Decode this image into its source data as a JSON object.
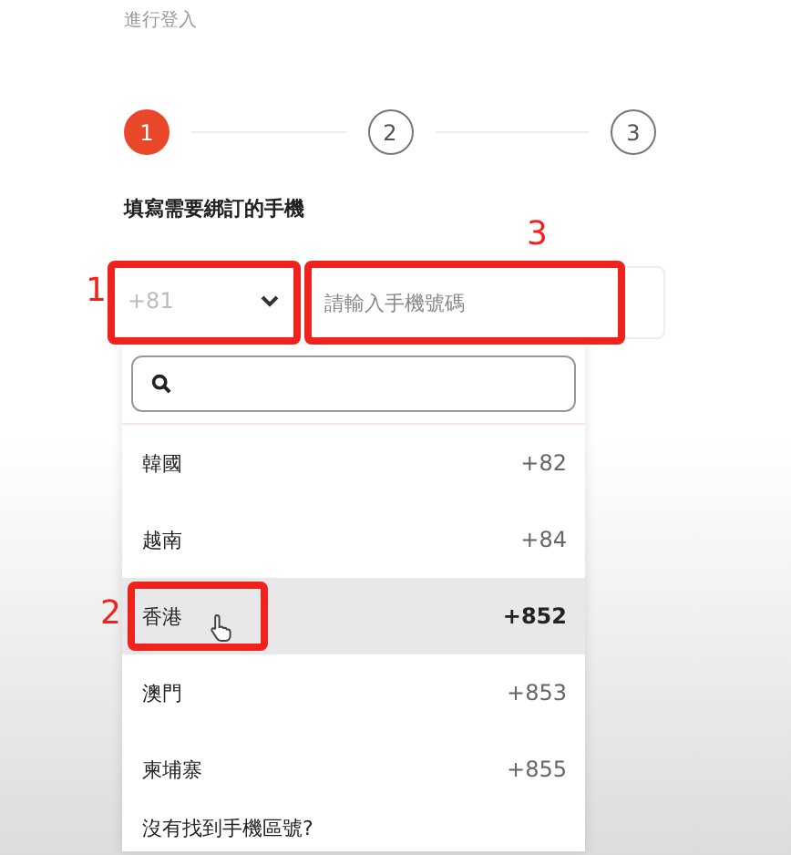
{
  "subtitle": "進行登入",
  "steps": [
    {
      "label": "1",
      "active": true
    },
    {
      "label": "2",
      "active": false
    },
    {
      "label": "3",
      "active": false
    }
  ],
  "form_label": "填寫需要綁訂的手機",
  "code_select": {
    "value": "+81",
    "annotation": "1"
  },
  "phone_field": {
    "placeholder": "請輸入手機號碼",
    "annotation": "3"
  },
  "dropdown": {
    "items": [
      {
        "name": "韓國",
        "code": "+82",
        "selected": false
      },
      {
        "name": "越南",
        "code": "+84",
        "selected": false
      },
      {
        "name": "香港",
        "code": "+852",
        "selected": true,
        "annotation": "2"
      },
      {
        "name": "澳門",
        "code": "+853",
        "selected": false
      },
      {
        "name": "柬埔寨",
        "code": "+855",
        "selected": false
      }
    ],
    "footer": "沒有找到手機區號?"
  }
}
